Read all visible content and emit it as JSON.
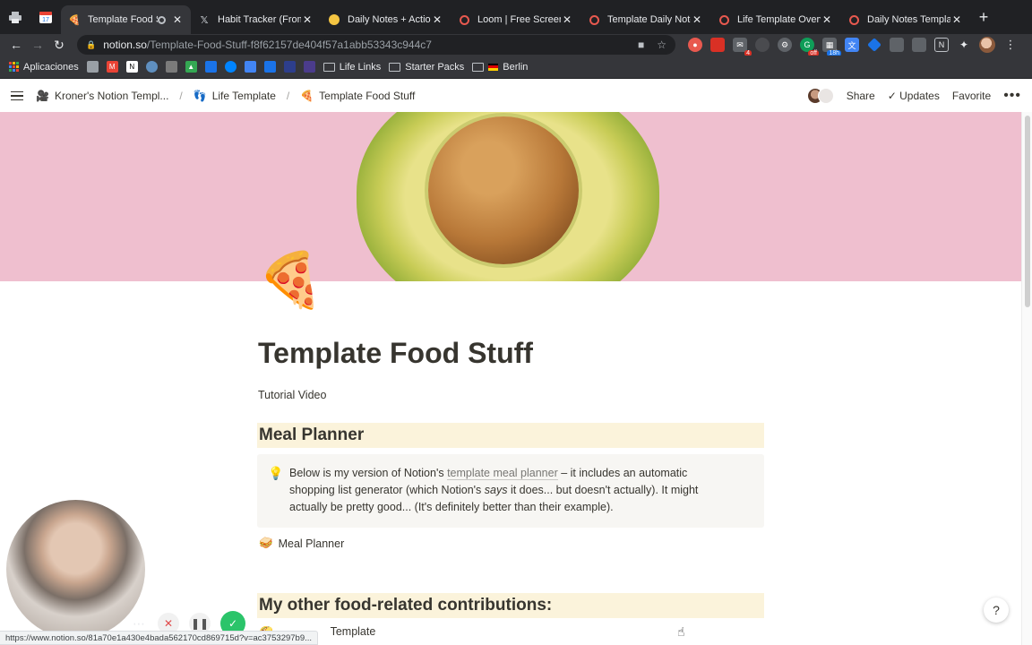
{
  "browser": {
    "pinned_tabs": [
      {
        "icon": "printer-icon"
      },
      {
        "icon": "calendar-icon",
        "label": "17"
      }
    ],
    "tabs": [
      {
        "title": "Template Food S",
        "icon": "pizza-icon",
        "active": true,
        "recording": true
      },
      {
        "title": "Habit Tracker (From",
        "icon": "notion-icon",
        "active": false
      },
      {
        "title": "Daily Notes + Action",
        "icon": "bulb-icon",
        "active": false
      },
      {
        "title": "Loom | Free Screen",
        "icon": "loom-icon",
        "active": false
      },
      {
        "title": "Template Daily Note",
        "icon": "loom-icon",
        "active": false
      },
      {
        "title": "Life Template Overvi",
        "icon": "loom-icon",
        "active": false
      },
      {
        "title": "Daily Notes Templat",
        "icon": "loom-icon",
        "active": false
      }
    ],
    "url_host": "notion.so",
    "url_path": "/Template-Food-Stuff-f8f62157de404f57a1abb53343c944c7",
    "bookmarks": [
      {
        "label": "Aplicaciones",
        "type": "apps"
      },
      {
        "label": "Life Links",
        "type": "folder"
      },
      {
        "label": "Starter Packs",
        "type": "folder"
      },
      {
        "label": "Berlin",
        "type": "folder"
      }
    ],
    "extension_badges": {
      "mail": "4",
      "off": "off",
      "timer": "18h"
    },
    "status_url": "https://www.notion.so/81a70e1a430e4bada562170cd869715d?v=ac3753297b9..."
  },
  "notion": {
    "breadcrumb": [
      {
        "icon": "🎥",
        "label": "Kroner's Notion Templ..."
      },
      {
        "icon": "👣",
        "label": "Life Template"
      },
      {
        "icon": "🍕",
        "label": "Template Food Stuff"
      }
    ],
    "topbar": {
      "share": "Share",
      "updates": "Updates",
      "favorite": "Favorite"
    },
    "page": {
      "icon": "🍕",
      "title": "Template Food Stuff",
      "tutorial": "Tutorial Video",
      "section1": "Meal Planner",
      "callout": {
        "pre": "Below is my version of Notion's ",
        "link": "template meal planner",
        "mid": " – it includes an automatic shopping list generator (which Notion's ",
        "em": "says",
        "post": " it does... but doesn't actually). It might actually be pretty good... (It's definitely better than their example)."
      },
      "subpage1": {
        "icon": "🥪",
        "label": "Meal Planner"
      },
      "section2": "My other food-related contributions:",
      "subpage2": {
        "icon": "🌮",
        "label": "Template"
      }
    },
    "help_label": "?"
  }
}
